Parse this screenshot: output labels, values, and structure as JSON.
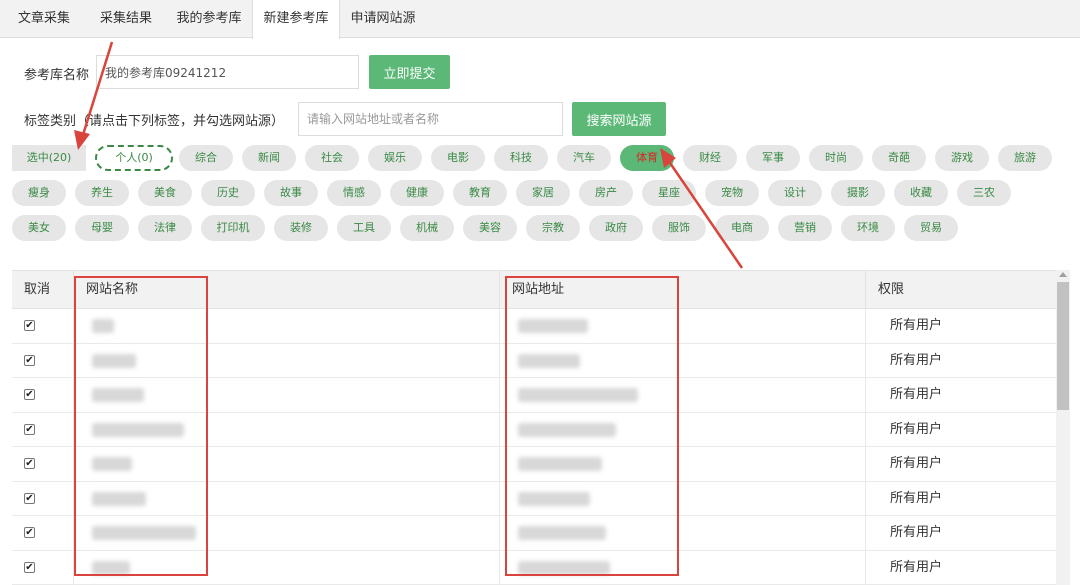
{
  "tabs": [
    {
      "label": "文章采集",
      "active": false
    },
    {
      "label": "采集结果",
      "active": false
    },
    {
      "label": "我的参考库",
      "active": false
    },
    {
      "label": "新建参考库",
      "active": true
    },
    {
      "label": "申请网站源",
      "active": false
    }
  ],
  "form": {
    "name_label": "参考库名称",
    "name_value": "我的参考库09241212",
    "submit_label": "立即提交",
    "tag_label": "标签类别（请点击下列标签，并勾选网站源）",
    "search_placeholder": "请输入网站地址或者名称",
    "search_button_label": "搜索网站源"
  },
  "tags": {
    "selected_count": "选中(20)",
    "personal": "个人(0)",
    "active_tag": "体育",
    "row1": [
      "综合",
      "新闻",
      "社会",
      "娱乐",
      "电影",
      "科技",
      "汽车",
      "体育",
      "财经",
      "军事",
      "时尚",
      "奇葩",
      "游戏",
      "旅游"
    ],
    "row2": [
      "瘦身",
      "养生",
      "美食",
      "历史",
      "故事",
      "情感",
      "健康",
      "教育",
      "家居",
      "房产",
      "星座",
      "宠物",
      "设计",
      "摄影",
      "收藏",
      "三农"
    ],
    "row3": [
      "美女",
      "母婴",
      "法律",
      "打印机",
      "装修",
      "工具",
      "机械",
      "美容",
      "宗教",
      "政府",
      "服饰",
      "电商",
      "营销",
      "环境",
      "贸易"
    ]
  },
  "table": {
    "headers": [
      "取消",
      "网站名称",
      "网站地址",
      "权限"
    ],
    "rows": [
      {
        "checked": true,
        "permission": "所有用户"
      },
      {
        "checked": true,
        "permission": "所有用户"
      },
      {
        "checked": true,
        "permission": "所有用户"
      },
      {
        "checked": true,
        "permission": "所有用户"
      },
      {
        "checked": true,
        "permission": "所有用户"
      },
      {
        "checked": true,
        "permission": "所有用户"
      },
      {
        "checked": true,
        "permission": "所有用户"
      },
      {
        "checked": true,
        "permission": "所有用户"
      }
    ]
  },
  "colors": {
    "accent_green": "#5cb877",
    "tag_text_green": "#3a8a45",
    "annotation_red": "#d9443c"
  },
  "icons": {
    "checkbox": "checkbox-checked-icon",
    "arrow": "red-arrow-icon"
  }
}
